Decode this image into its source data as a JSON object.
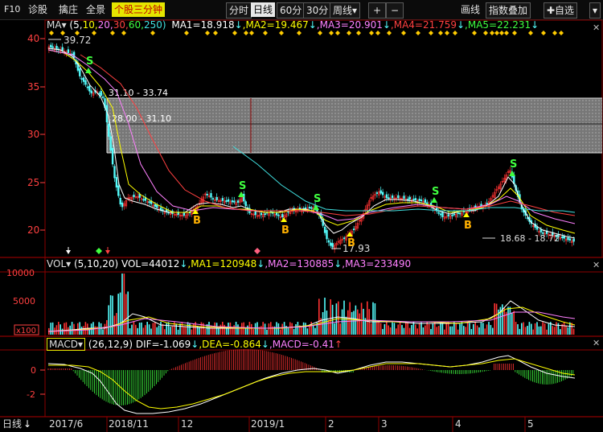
{
  "toolbar": {
    "f10": "F10",
    "diagnose": "诊股",
    "pick": "擒庄",
    "overview": "全景",
    "three_min": "个股三分钟",
    "timeshare": "分时",
    "daily": "日线",
    "min60": "60分",
    "min30": "30分",
    "weekly": "周线",
    "weekly_arrow": "▾",
    "zoom_in": "+",
    "zoom_out": "−",
    "draw": "画线",
    "index_overlay": "指数叠加",
    "self_select": "✚自选",
    "more": "▾"
  },
  "ma_legend": {
    "name": "MA▾",
    "params_open": "(5,",
    "p10": "10,",
    "p20": "20,",
    "p30": "30,",
    "p60": "60,",
    "p250": "250)",
    "ma1": "MA1=18.918",
    "ma2": ",MA2=19.467",
    "ma3": ",MA3=20.901",
    "ma4": ",MA4=21.759",
    "ma5": ",MA5=22.231",
    "arrow": "↓"
  },
  "price_panel": {
    "y_ticks": [
      "40",
      "35",
      "30",
      "25",
      "20"
    ],
    "high_label": "39.72",
    "low_label": "17.93",
    "gap_upper": "31.10 - 33.74",
    "gap_lower": "28.00 - 31.10",
    "last_range": "18.68 - 18.72",
    "signals": {
      "s": "S",
      "b": "B"
    }
  },
  "vol_legend": {
    "name": "VOL▾",
    "params": "(5,10,20)",
    "vol": "VOL=44012",
    "ma1": ",MA1=120948",
    "ma2": ",MA2=130885",
    "ma3": ",MA3=233490",
    "arrow": "↓"
  },
  "vol_panel": {
    "y_ticks": [
      "10000",
      "5000"
    ],
    "unit": "x100"
  },
  "macd_legend": {
    "name": "MACD▾",
    "params": "(26,12,9)",
    "dif": "DIF=-1.069",
    "dea": ",DEA=-0.864",
    "macd": ",MACD=-0.41",
    "arrow": "↓",
    "up_arrow": "↑"
  },
  "macd_panel": {
    "y_ticks": [
      "0",
      "-2"
    ]
  },
  "x_axis": {
    "period": "日线",
    "labels": [
      "2017/6",
      "2018/11",
      "12",
      "2019/1",
      "2",
      "3",
      "4",
      "5"
    ]
  },
  "colors": {
    "up": "#ff3232",
    "down": "#54fcfc",
    "ma5": "#ffffff",
    "ma10": "#ffff00",
    "ma20": "#ff80ff",
    "ma30": "#ff4040",
    "ma60": "#40ff40",
    "ma250": "#40e0e0",
    "accent": "#e5e500"
  }
}
